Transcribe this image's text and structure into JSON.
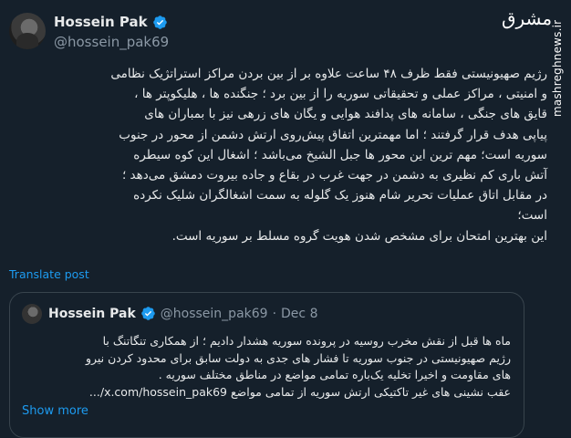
{
  "author": {
    "name": "Hossein Pak",
    "handle": "@hossein_pak69"
  },
  "watermark": {
    "logo_text": "مشرق",
    "site_url": "mashreghnews.ir"
  },
  "post": {
    "lines": [
      "رژیم صهیونیستی فقط ظرف ۴۸ ساعت علاوه بر از بین بردن مراکز استراتژیک نظامی",
      "و امنیتی ، مراکز عملی و تحقیقاتی سوریه را از بین برد ؛ جنگنده ها ، هلیکوپتر ها ،",
      "قایق های جنگی ، سامانه های پدافند هوایی و یگان های زرهی نیز با بمباران های",
      "پیاپی هدف قرار گرفتند ؛ اما مهمترین اتفاق پیش‌روی ارتش دشمن از محور در جنوب",
      "سوریه است؛ مهم ترین این محور ها جبل الشیخ می‌باشد ؛ اشغال این کوه سیطره",
      "آتش باری کم نظیری به دشمن در جهت غرب در بقاع و جاده بیروت دمشق می‌دهد ؛",
      "در مقابل اتاق عملیات تحریر شام هنوز یک گلوله به سمت اشغالگران شلیک نکرده",
      "است؛",
      "این بهترین امتحان برای مشخص شدن هویت گروه مسلط بر سوریه است."
    ],
    "translate_label": "Translate post"
  },
  "quote": {
    "name": "Hossein Pak",
    "handle": "@hossein_pak69",
    "separator": "·",
    "date": "Dec 8",
    "lines": [
      "ماه ها قبل از نقش مخرب روسیه در پرونده سوریه هشدار دادیم ؛ از همکاری تنگاتنگ با",
      "رژیم صهیونیستی در جنوب سوریه تا فشار های جدی به دولت سابق برای محدود کردن نیرو",
      "های مقاومت و اخیرا تخلیه یک‌باره تمامی مواضع در مناطق مختلف سوریه .",
      "عقب نشینی های غیر تاکتیکی ارتش سوریه از تمامی مواضع x.com/hossein_pak69/..."
    ],
    "show_more": "Show more"
  },
  "colors": {
    "background": "#15202b",
    "accent": "#1d9bf0",
    "text": "#e7e9ea",
    "muted": "#8b98a5",
    "border": "#38444d"
  }
}
